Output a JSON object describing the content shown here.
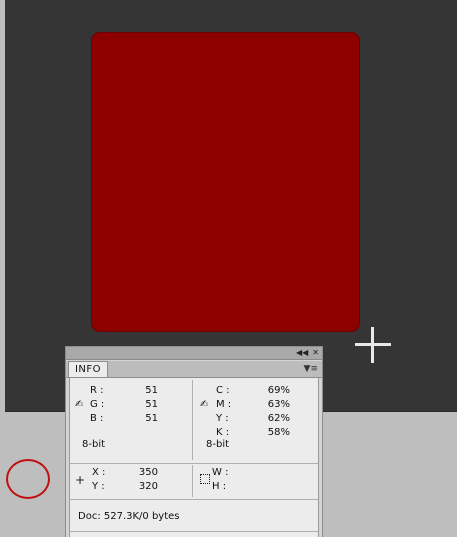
{
  "panel": {
    "tab_label": "INFO",
    "rgb": {
      "r_label": "R :",
      "r_value": "51",
      "g_label": "G :",
      "g_value": "51",
      "b_label": "B :",
      "b_value": "51",
      "bitdepth": "8-bit"
    },
    "cmyk": {
      "c_label": "C :",
      "c_value": "69%",
      "m_label": "M :",
      "m_value": "63%",
      "y_label": "Y :",
      "y_value": "62%",
      "k_label": "K :",
      "k_value": "58%",
      "bitdepth": "8-bit"
    },
    "position": {
      "x_label": "X :",
      "x_value": "350",
      "y_label": "Y :",
      "y_value": "320"
    },
    "size": {
      "w_label": "W :",
      "h_label": "H :"
    },
    "doc_info": "Doc: 527.3K/0 bytes"
  },
  "colors": {
    "document_fill": "#8c0000",
    "canvas_bg": "#353535",
    "annotation_circle": "#c01010"
  },
  "icons": {
    "eyedropper_rgb": "eyedropper-icon",
    "eyedropper_cmyk": "eyedropper-icon",
    "position": "crosshair-plus-icon",
    "selection": "marquee-icon",
    "collapse": "double-arrow-icon",
    "close": "close-icon",
    "panel_menu": "panel-menu-icon"
  }
}
